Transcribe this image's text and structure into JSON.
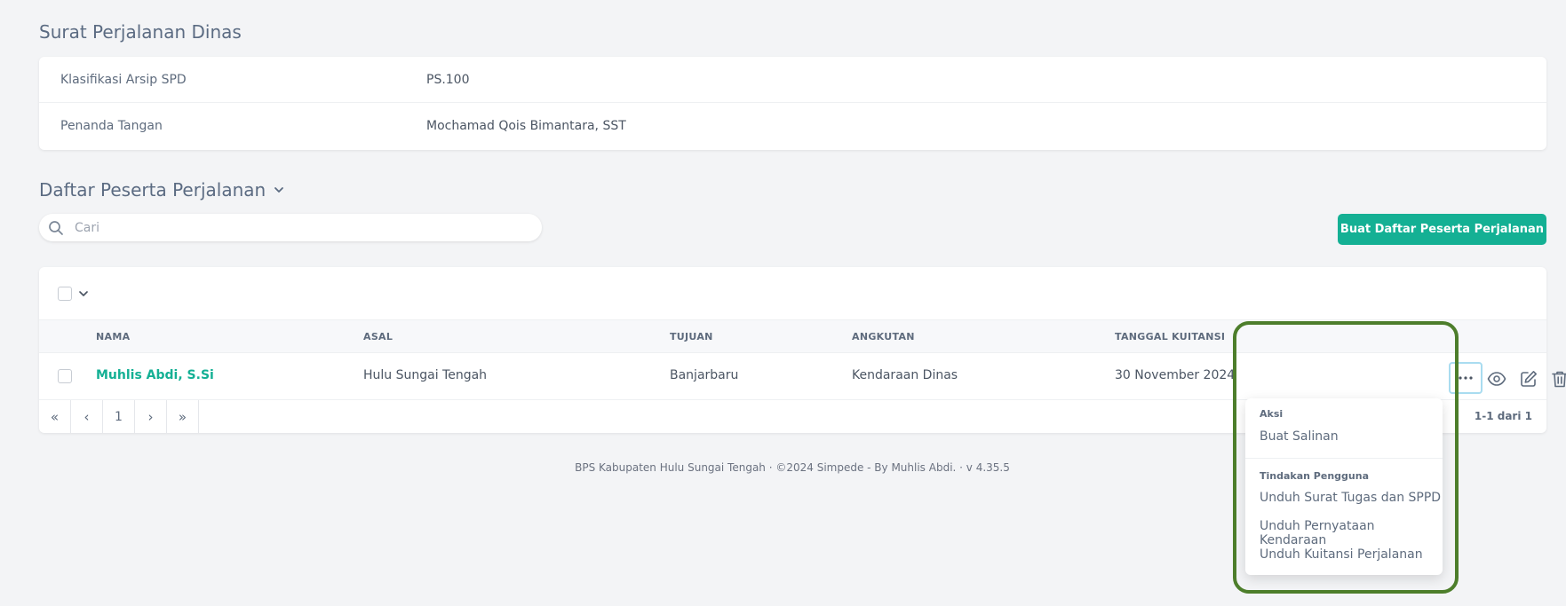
{
  "page": {
    "title": "Surat Perjalanan Dinas"
  },
  "details": [
    {
      "label": "Klasifikasi Arsip SPD",
      "value": "PS.100"
    },
    {
      "label": "Penanda Tangan",
      "value": "Mochamad Qois Bimantara, SST"
    }
  ],
  "participants": {
    "title": "Daftar Peserta Perjalanan",
    "search_placeholder": "Cari",
    "create_button": "Buat Daftar Peserta Perjalanan",
    "columns": [
      "NAMA",
      "ASAL",
      "TUJUAN",
      "ANGKUTAN",
      "TANGGAL KUITANSI"
    ],
    "rows": [
      {
        "nama": "Muhlis Abdi, S.Si",
        "asal": "Hulu Sungai Tengah",
        "tujuan": "Banjarbaru",
        "angkutan": "Kendaraan Dinas",
        "tanggal_kuitansi": "30 November 2024"
      }
    ],
    "pagination": {
      "first": "«",
      "prev": "‹",
      "current": "1",
      "next": "›",
      "last": "»",
      "info": "1-1 dari 1"
    }
  },
  "dropdown": {
    "heading_actions": "Aksi",
    "copy": "Buat Salinan",
    "heading_user_actions": "Tindakan Pengguna",
    "items": [
      "Unduh Surat Tugas dan SPPD",
      "Unduh Pernyataan Kendaraan",
      "Unduh Kuitansi Perjalanan"
    ]
  },
  "footer": {
    "text": "BPS Kabupaten Hulu Sungai Tengah  ·  ©2024 Simpede - By Muhlis Abdi.  ·  v 4.35.5"
  },
  "colors": {
    "accent": "#14b094",
    "highlight": "#4d7e2b",
    "focus_ring": "#a9dcf0"
  }
}
